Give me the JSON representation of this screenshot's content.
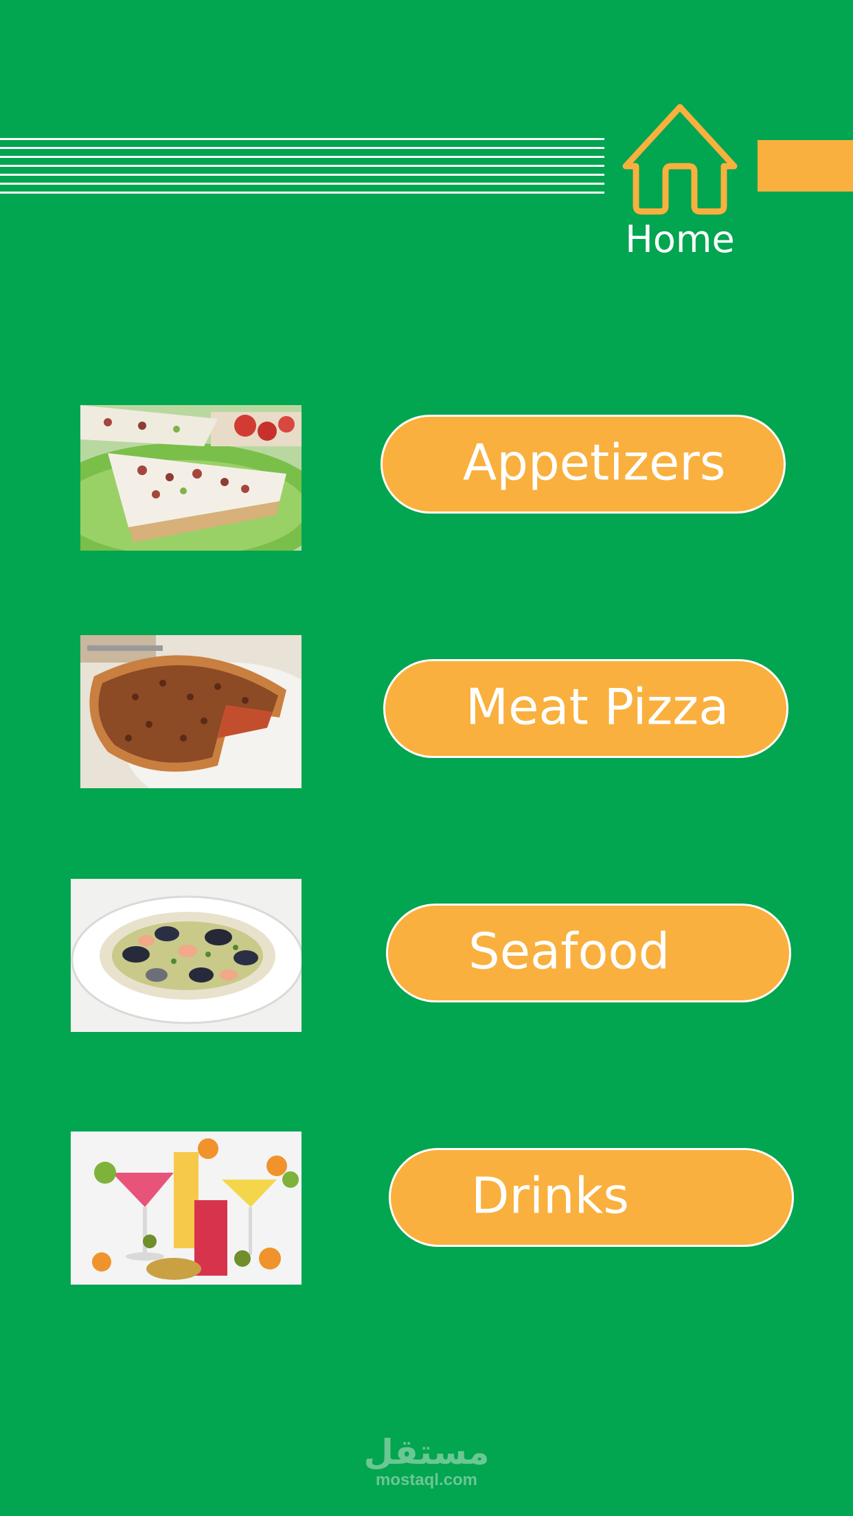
{
  "header": {
    "home_label": "Home",
    "home_icon": "house-outline-icon"
  },
  "menu": {
    "items": [
      {
        "label": "Appetizers",
        "image": "appetizer-tart-photo"
      },
      {
        "label": "Meat Pizza",
        "image": "meat-pizza-photo"
      },
      {
        "label": "Seafood",
        "image": "seafood-pasta-photo"
      },
      {
        "label": "Drinks",
        "image": "fruit-drinks-photo"
      }
    ]
  },
  "footer": {
    "watermark_text": "مستقل",
    "watermark_url": "mostaql.com"
  },
  "colors": {
    "background": "#02a550",
    "accent": "#f9b03e",
    "text": "#ffffff"
  }
}
